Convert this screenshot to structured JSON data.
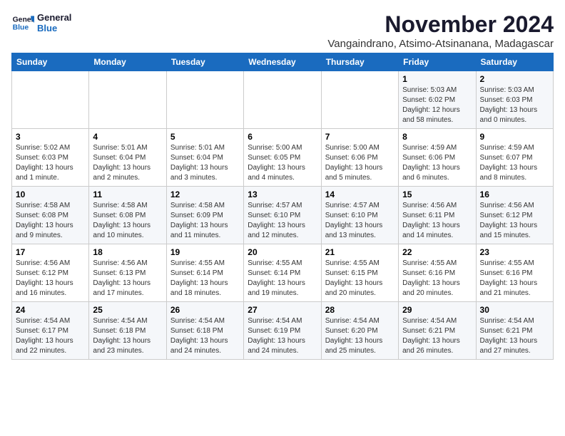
{
  "logo": {
    "line1": "General",
    "line2": "Blue"
  },
  "title": "November 2024",
  "subtitle": "Vangaindrano, Atsimo-Atsinanana, Madagascar",
  "days_of_week": [
    "Sunday",
    "Monday",
    "Tuesday",
    "Wednesday",
    "Thursday",
    "Friday",
    "Saturday"
  ],
  "weeks": [
    [
      {
        "day": "",
        "info": ""
      },
      {
        "day": "",
        "info": ""
      },
      {
        "day": "",
        "info": ""
      },
      {
        "day": "",
        "info": ""
      },
      {
        "day": "",
        "info": ""
      },
      {
        "day": "1",
        "info": "Sunrise: 5:03 AM\nSunset: 6:02 PM\nDaylight: 12 hours\nand 58 minutes."
      },
      {
        "day": "2",
        "info": "Sunrise: 5:03 AM\nSunset: 6:03 PM\nDaylight: 13 hours\nand 0 minutes."
      }
    ],
    [
      {
        "day": "3",
        "info": "Sunrise: 5:02 AM\nSunset: 6:03 PM\nDaylight: 13 hours\nand 1 minute."
      },
      {
        "day": "4",
        "info": "Sunrise: 5:01 AM\nSunset: 6:04 PM\nDaylight: 13 hours\nand 2 minutes."
      },
      {
        "day": "5",
        "info": "Sunrise: 5:01 AM\nSunset: 6:04 PM\nDaylight: 13 hours\nand 3 minutes."
      },
      {
        "day": "6",
        "info": "Sunrise: 5:00 AM\nSunset: 6:05 PM\nDaylight: 13 hours\nand 4 minutes."
      },
      {
        "day": "7",
        "info": "Sunrise: 5:00 AM\nSunset: 6:06 PM\nDaylight: 13 hours\nand 5 minutes."
      },
      {
        "day": "8",
        "info": "Sunrise: 4:59 AM\nSunset: 6:06 PM\nDaylight: 13 hours\nand 6 minutes."
      },
      {
        "day": "9",
        "info": "Sunrise: 4:59 AM\nSunset: 6:07 PM\nDaylight: 13 hours\nand 8 minutes."
      }
    ],
    [
      {
        "day": "10",
        "info": "Sunrise: 4:58 AM\nSunset: 6:08 PM\nDaylight: 13 hours\nand 9 minutes."
      },
      {
        "day": "11",
        "info": "Sunrise: 4:58 AM\nSunset: 6:08 PM\nDaylight: 13 hours\nand 10 minutes."
      },
      {
        "day": "12",
        "info": "Sunrise: 4:58 AM\nSunset: 6:09 PM\nDaylight: 13 hours\nand 11 minutes."
      },
      {
        "day": "13",
        "info": "Sunrise: 4:57 AM\nSunset: 6:10 PM\nDaylight: 13 hours\nand 12 minutes."
      },
      {
        "day": "14",
        "info": "Sunrise: 4:57 AM\nSunset: 6:10 PM\nDaylight: 13 hours\nand 13 minutes."
      },
      {
        "day": "15",
        "info": "Sunrise: 4:56 AM\nSunset: 6:11 PM\nDaylight: 13 hours\nand 14 minutes."
      },
      {
        "day": "16",
        "info": "Sunrise: 4:56 AM\nSunset: 6:12 PM\nDaylight: 13 hours\nand 15 minutes."
      }
    ],
    [
      {
        "day": "17",
        "info": "Sunrise: 4:56 AM\nSunset: 6:12 PM\nDaylight: 13 hours\nand 16 minutes."
      },
      {
        "day": "18",
        "info": "Sunrise: 4:56 AM\nSunset: 6:13 PM\nDaylight: 13 hours\nand 17 minutes."
      },
      {
        "day": "19",
        "info": "Sunrise: 4:55 AM\nSunset: 6:14 PM\nDaylight: 13 hours\nand 18 minutes."
      },
      {
        "day": "20",
        "info": "Sunrise: 4:55 AM\nSunset: 6:14 PM\nDaylight: 13 hours\nand 19 minutes."
      },
      {
        "day": "21",
        "info": "Sunrise: 4:55 AM\nSunset: 6:15 PM\nDaylight: 13 hours\nand 20 minutes."
      },
      {
        "day": "22",
        "info": "Sunrise: 4:55 AM\nSunset: 6:16 PM\nDaylight: 13 hours\nand 20 minutes."
      },
      {
        "day": "23",
        "info": "Sunrise: 4:55 AM\nSunset: 6:16 PM\nDaylight: 13 hours\nand 21 minutes."
      }
    ],
    [
      {
        "day": "24",
        "info": "Sunrise: 4:54 AM\nSunset: 6:17 PM\nDaylight: 13 hours\nand 22 minutes."
      },
      {
        "day": "25",
        "info": "Sunrise: 4:54 AM\nSunset: 6:18 PM\nDaylight: 13 hours\nand 23 minutes."
      },
      {
        "day": "26",
        "info": "Sunrise: 4:54 AM\nSunset: 6:18 PM\nDaylight: 13 hours\nand 24 minutes."
      },
      {
        "day": "27",
        "info": "Sunrise: 4:54 AM\nSunset: 6:19 PM\nDaylight: 13 hours\nand 24 minutes."
      },
      {
        "day": "28",
        "info": "Sunrise: 4:54 AM\nSunset: 6:20 PM\nDaylight: 13 hours\nand 25 minutes."
      },
      {
        "day": "29",
        "info": "Sunrise: 4:54 AM\nSunset: 6:21 PM\nDaylight: 13 hours\nand 26 minutes."
      },
      {
        "day": "30",
        "info": "Sunrise: 4:54 AM\nSunset: 6:21 PM\nDaylight: 13 hours\nand 27 minutes."
      }
    ]
  ]
}
